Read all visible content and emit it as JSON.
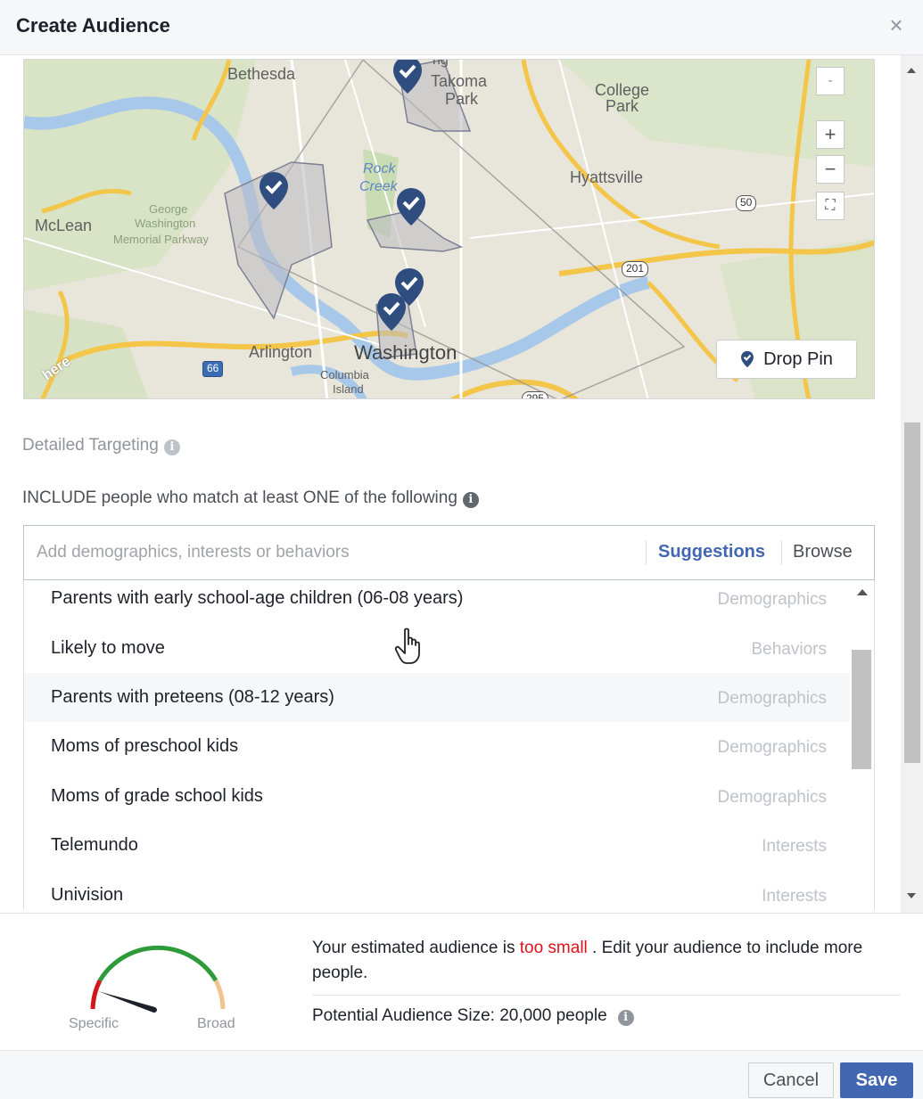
{
  "dialog": {
    "title": "Create Audience",
    "close_icon": "close-icon"
  },
  "map": {
    "labels": {
      "bethesda": "Bethesda",
      "takoma": "Takoma",
      "park": "Park",
      "college": "College",
      "college_park": "Park",
      "hyattsville": "Hyattsville",
      "mclean": "McLean",
      "rock": "Rock",
      "creek": "Creek",
      "george": "George",
      "washington_pkwy": "Washington",
      "memorial": "Memorial Parkway",
      "arlington": "Arlington",
      "washington": "Washington",
      "columbia": "Columbia",
      "island": "Island",
      "ng": "ng",
      "here": "here"
    },
    "shields": {
      "us50": "50",
      "r201": "201",
      "i66": "66",
      "r295": "295"
    },
    "controls": {
      "collapse": "-",
      "zoom_in": "+",
      "zoom_out": "−",
      "fit": "⛶"
    },
    "drop_pin_label": "Drop Pin"
  },
  "targeting": {
    "section_label": "Detailed Targeting",
    "include_label": "INCLUDE people who match at least ONE of the following",
    "search_placeholder": "Add demographics, interests or behaviors",
    "suggestions_label": "Suggestions",
    "browse_label": "Browse",
    "results": [
      {
        "name": "Parents with early school-age children (06-08 years)",
        "category": "Demographics"
      },
      {
        "name": "Likely to move",
        "category": "Behaviors"
      },
      {
        "name": "Parents with preteens (08-12 years)",
        "category": "Demographics"
      },
      {
        "name": "Moms of preschool kids",
        "category": "Demographics"
      },
      {
        "name": "Moms of grade school kids",
        "category": "Demographics"
      },
      {
        "name": "Telemundo",
        "category": "Interests"
      },
      {
        "name": "Univision",
        "category": "Interests"
      }
    ]
  },
  "audience": {
    "gauge_specific": "Specific",
    "gauge_broad": "Broad",
    "gauge_level": 0.08,
    "est_prefix": "Your estimated audience is ",
    "est_warning": "too small",
    "est_suffix": " . Edit your audience to include more people.",
    "potential_size": "Potential Audience Size: 20,000 people"
  },
  "buttons": {
    "cancel": "Cancel",
    "save": "Save"
  },
  "colors": {
    "brand": "#4267b2",
    "warning": "#e0111a",
    "pin": "#2f4d7e"
  }
}
